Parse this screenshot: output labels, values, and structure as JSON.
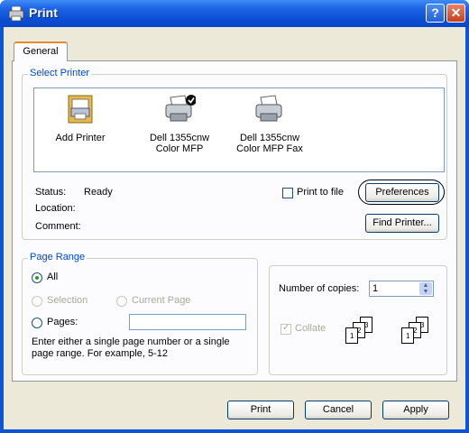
{
  "window": {
    "title": "Print"
  },
  "tabs": [
    {
      "label": "General"
    }
  ],
  "select_printer": {
    "group_label": "Select Printer",
    "printers": [
      {
        "label_line1": "Add Printer",
        "label_line2": ""
      },
      {
        "label_line1": "Dell 1355cnw",
        "label_line2": "Color MFP"
      },
      {
        "label_line1": "Dell 1355cnw",
        "label_line2": "Color MFP Fax"
      }
    ],
    "status_label": "Status:",
    "status_value": "Ready",
    "location_label": "Location:",
    "comment_label": "Comment:",
    "print_to_file_label": "Print to file",
    "preferences_label": "Preferences",
    "find_printer_label": "Find Printer..."
  },
  "page_range": {
    "group_label": "Page Range",
    "all_label": "All",
    "selection_label": "Selection",
    "current_page_label": "Current Page",
    "pages_label": "Pages:",
    "pages_value": "",
    "hint": "Enter either a single page number or a single page range.  For example, 5-12"
  },
  "copies": {
    "number_label": "Number of copies:",
    "number_value": "1",
    "collate_label": "Collate"
  },
  "buttons": {
    "print": "Print",
    "cancel": "Cancel",
    "apply": "Apply"
  }
}
